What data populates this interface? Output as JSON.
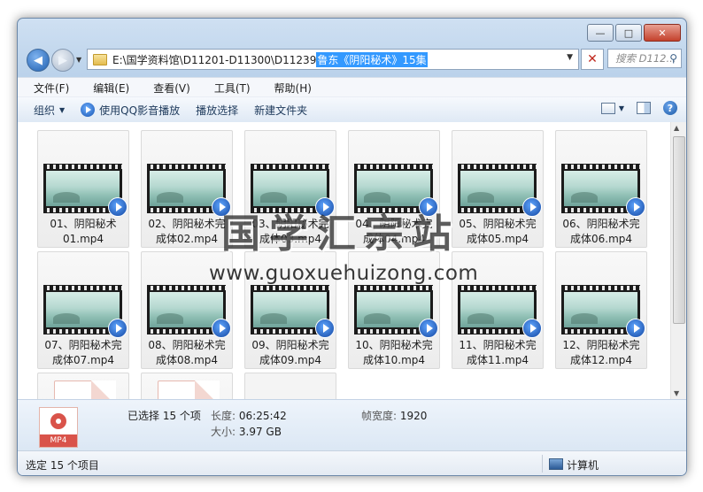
{
  "window": {
    "controls": {
      "minimize": "—",
      "maximize": "□",
      "close": "✕"
    },
    "colors": {
      "accent": "#3399ff",
      "close": "#c4412c"
    }
  },
  "address": {
    "path": "E:\\国学资料馆\\D11201-D11300\\D11239 ",
    "selected": "鲁东《阴阳秘术》15集",
    "dropdown": "▼",
    "refresh": "✕"
  },
  "search": {
    "placeholder": "搜索 D112...",
    "icon": "search-icon"
  },
  "menu": [
    "文件(F)",
    "编辑(E)",
    "查看(V)",
    "工具(T)",
    "帮助(H)"
  ],
  "toolbar": {
    "organize": "组织",
    "play_qq": "使用QQ影音播放",
    "play_select": "播放选择",
    "new_folder": "新建文件夹",
    "help": "?"
  },
  "files": [
    {
      "line1": "01、阴阳秘术",
      "line2": "01.mp4"
    },
    {
      "line1": "02、阴阳秘术完",
      "line2": "成体02.mp4"
    },
    {
      "line1": "03、阴阳秘术完",
      "line2": "成体03.mp4"
    },
    {
      "line1": "04、阴阳秘术完",
      "line2": "成体04.mp4"
    },
    {
      "line1": "05、阴阳秘术完",
      "line2": "成体05.mp4"
    },
    {
      "line1": "06、阴阳秘术完",
      "line2": "成体06.mp4"
    },
    {
      "line1": "07、阴阳秘术完",
      "line2": "成体07.mp4"
    },
    {
      "line1": "08、阴阳秘术完",
      "line2": "成体08.mp4"
    },
    {
      "line1": "09、阴阳秘术完",
      "line2": "成体09.mp4"
    },
    {
      "line1": "10、阴阳秘术完",
      "line2": "成体10.mp4"
    },
    {
      "line1": "11、阴阳秘术完",
      "line2": "成体11.mp4"
    },
    {
      "line1": "12、阴阳秘术完",
      "line2": "成体12.mp4"
    }
  ],
  "details": {
    "selected": "已选择 15 个项",
    "length_label": "长度:",
    "length_value": "06:25:42",
    "size_label": "大小:",
    "size_value": "3.97 GB",
    "width_label": "帧宽度:",
    "width_value": "1920",
    "icon_tag": "MP4"
  },
  "status": {
    "left": "选定 15 个项目",
    "right": "计算机"
  },
  "watermark": {
    "cn": "国学汇宗站",
    "url": "www.guoxuehuizong.com"
  }
}
